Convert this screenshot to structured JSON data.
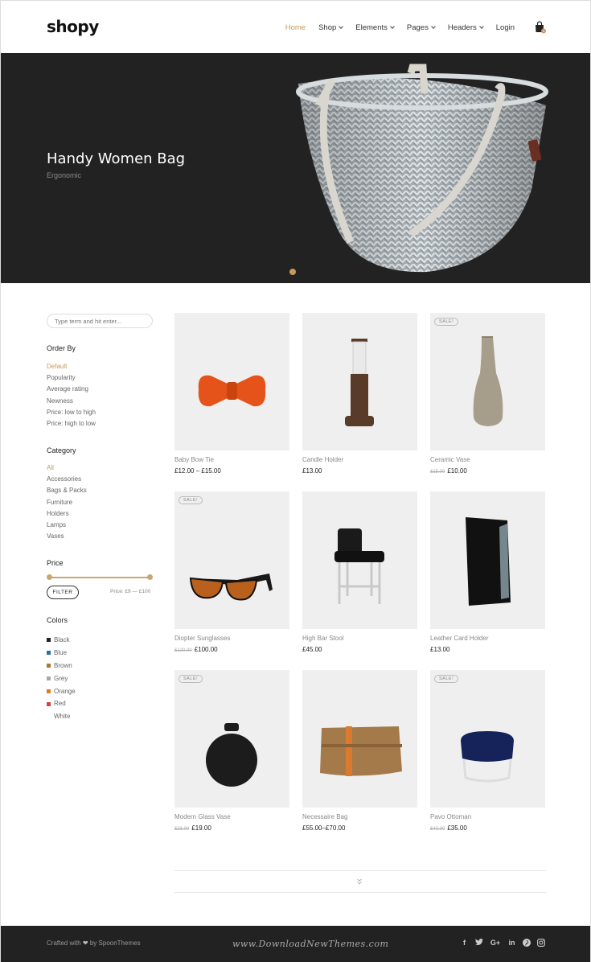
{
  "header": {
    "logo": "shopy",
    "nav": [
      {
        "label": "Home",
        "active": true,
        "dropdown": false
      },
      {
        "label": "Shop",
        "dropdown": true
      },
      {
        "label": "Elements",
        "dropdown": true
      },
      {
        "label": "Pages",
        "dropdown": true
      },
      {
        "label": "Headers",
        "dropdown": true
      },
      {
        "label": "Login",
        "dropdown": false
      }
    ],
    "cart_count": "0"
  },
  "hero": {
    "title": "Handy Women Bag",
    "subtitle": "Ergonomic"
  },
  "sidebar": {
    "search_placeholder": "Type term and hit enter...",
    "order_title": "Order By",
    "order_items": [
      "Default",
      "Popularity",
      "Average rating",
      "Newness",
      "Price: low to high",
      "Price: high to low"
    ],
    "category_title": "Category",
    "category_items": [
      "All",
      "Accessories",
      "Bags & Packs",
      "Furniture",
      "Holders",
      "Lamps",
      "Vases"
    ],
    "price_title": "Price",
    "filter_label": "FILTER",
    "price_range": "Price: £9 — £100",
    "colors_title": "Colors",
    "colors": [
      {
        "name": "Black",
        "hex": "#222222"
      },
      {
        "name": "Blue",
        "hex": "#2e6fa0"
      },
      {
        "name": "Brown",
        "hex": "#a8782b"
      },
      {
        "name": "Grey",
        "hex": "#aaaaaa"
      },
      {
        "name": "Orange",
        "hex": "#e07a22"
      },
      {
        "name": "Red",
        "hex": "#d94040"
      },
      {
        "name": "White",
        "hex": "#ffffff"
      }
    ]
  },
  "products": [
    {
      "name": "Baby Bow Tie",
      "price": "£12.00 – £15.00",
      "old": "",
      "sale": false,
      "icon": "bow-tie-icon"
    },
    {
      "name": "Candle Holder",
      "price": "£13.00",
      "old": "",
      "sale": false,
      "icon": "candle-holder-icon"
    },
    {
      "name": "Ceramic Vase",
      "price": "£10.00",
      "old": "£15.00",
      "sale": true,
      "icon": "vase-icon"
    },
    {
      "name": "Diopter Sunglasses",
      "price": "£100.00",
      "old": "£120.00",
      "sale": true,
      "icon": "sunglasses-icon"
    },
    {
      "name": "High Bar Stool",
      "price": "£45.00",
      "old": "",
      "sale": false,
      "icon": "bar-stool-icon"
    },
    {
      "name": "Leather Card Holder",
      "price": "£13.00",
      "old": "",
      "sale": false,
      "icon": "card-holder-icon"
    },
    {
      "name": "Modern Glass Vase",
      "price": "£19.00",
      "old": "£23.00",
      "sale": true,
      "icon": "glass-vase-icon"
    },
    {
      "name": "Necessaire Bag",
      "price": "£55.00–£70.00",
      "old": "",
      "sale": false,
      "icon": "necessaire-bag-icon"
    },
    {
      "name": "Pavo Ottoman",
      "price": "£35.00",
      "old": "£40.00",
      "sale": true,
      "icon": "ottoman-icon"
    }
  ],
  "sale_label": "SALE!",
  "footer": {
    "crafted": "Crafted with",
    "by": "by SpoonThemes",
    "watermark": "www.DownloadNewThemes.com"
  },
  "colors": {
    "accent": "#c8995b",
    "dark": "#222222"
  }
}
